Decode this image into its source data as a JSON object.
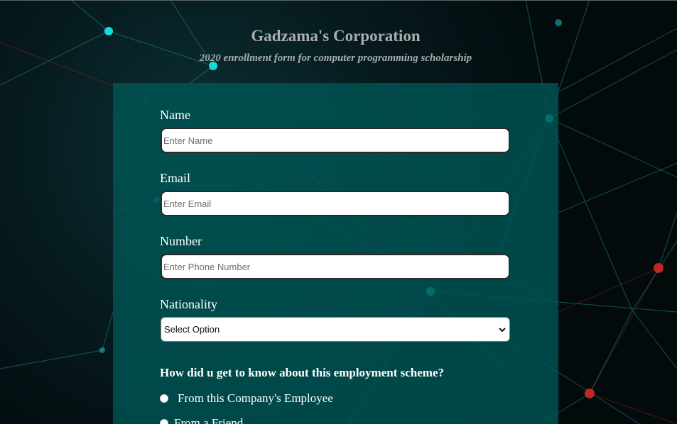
{
  "header": {
    "title": "Gadzama's Corporation",
    "subtitle": "2020 enrollment form for computer programming scholarship"
  },
  "form": {
    "name": {
      "label": "Name",
      "placeholder": "Enter Name"
    },
    "email": {
      "label": "Email",
      "placeholder": "Enter Email"
    },
    "number": {
      "label": "Number",
      "placeholder": "Enter Phone Number"
    },
    "nationality": {
      "label": "Nationality",
      "selected": "Select Option"
    },
    "question": "How did u get to know about this employment scheme?",
    "options": [
      {
        "label": "From this Company's Employee"
      },
      {
        "label": "From a Friend"
      }
    ]
  },
  "colors": {
    "panel": "#005454",
    "title_text": "#a8adad",
    "node_cyan": "#18d8d8",
    "node_red": "#e02a2a"
  },
  "icons": {
    "select": "chevron-down-icon"
  }
}
